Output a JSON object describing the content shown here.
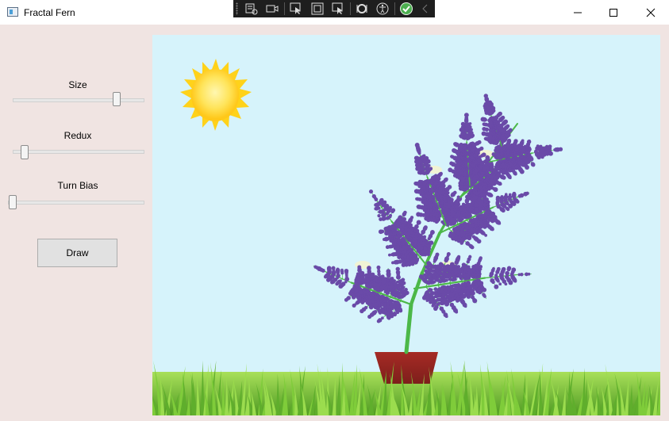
{
  "window": {
    "title": "Fractal Fern"
  },
  "sidebar": {
    "size_label": "Size",
    "redux_label": "Redux",
    "turn_bias_label": "Turn Bias",
    "draw_label": "Draw",
    "size_value": 0.8,
    "redux_value": 0.09,
    "turn_bias_value": 0.0
  },
  "colors": {
    "sky": "#d6f3fb",
    "stem": "#4cb848",
    "berries": "#6a4aa8",
    "pot": "#a8322a",
    "sun": "#ffe14a",
    "grass": "#6cc336"
  }
}
